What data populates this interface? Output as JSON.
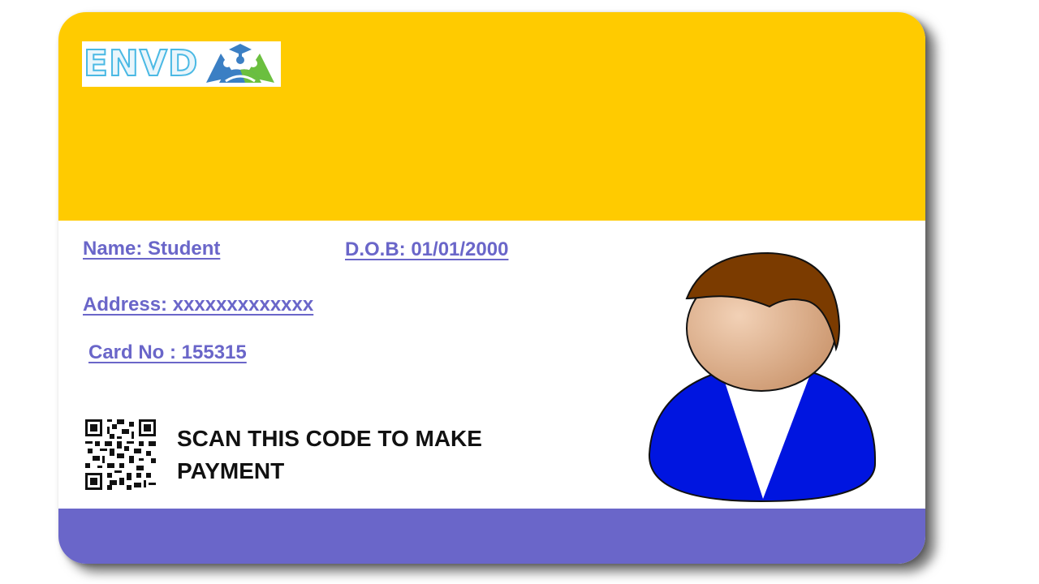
{
  "logo": {
    "text": "ENVD",
    "icon": "graduation-people-icon"
  },
  "fields": {
    "name": "Name: Student",
    "dob": "D.O.B: 01/01/2000",
    "address": "Address: xxxxxxxxxxxxx",
    "card_no": "Card No : 155315"
  },
  "scan_text": "SCAN THIS CODE TO MAKE PAYMENT",
  "icons": {
    "qr": "qr-code-icon",
    "avatar": "person-avatar-icon"
  },
  "colors": {
    "top_band": "#ffcb00",
    "bottom_band": "#6a66c9",
    "field_text": "#6a66c9",
    "avatar_jacket": "#0015e0",
    "avatar_hair": "#7b3b00"
  }
}
